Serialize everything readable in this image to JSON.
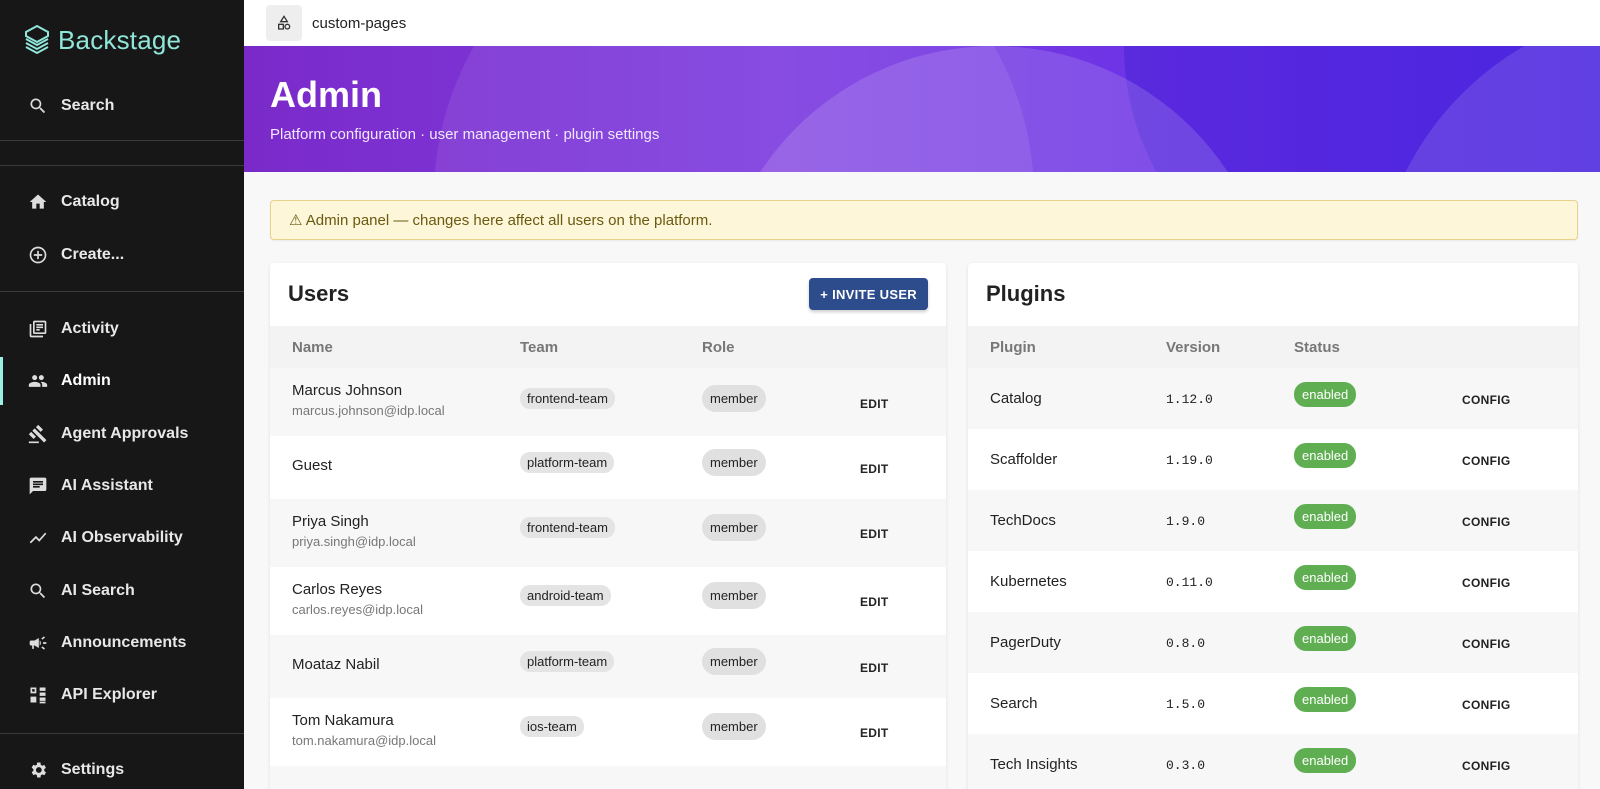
{
  "sidebar": {
    "brand": "Backstage",
    "search_label": "Search",
    "items": [
      {
        "label": "Catalog",
        "icon": "home-icon"
      },
      {
        "label": "Create...",
        "icon": "add-circle-icon"
      },
      {
        "label": "Activity",
        "icon": "activity-icon"
      },
      {
        "label": "Admin",
        "icon": "people-icon",
        "active": true
      },
      {
        "label": "Agent Approvals",
        "icon": "gavel-icon"
      },
      {
        "label": "AI Assistant",
        "icon": "chat-icon"
      },
      {
        "label": "AI Observability",
        "icon": "trending-icon"
      },
      {
        "label": "AI Search",
        "icon": "search-icon"
      },
      {
        "label": "Announcements",
        "icon": "megaphone-icon"
      },
      {
        "label": "API Explorer",
        "icon": "api-icon"
      }
    ],
    "settings_label": "Settings"
  },
  "topbar": {
    "breadcrumb": "custom-pages"
  },
  "header": {
    "title": "Admin",
    "subtitle": "Platform configuration · user management · plugin settings"
  },
  "warning": {
    "text": "⚠ Admin panel — changes here affect all users on the platform."
  },
  "users": {
    "title": "Users",
    "invite_label": "+ INVITE USER",
    "columns": [
      "Name",
      "Team",
      "Role"
    ],
    "edit_label": "EDIT",
    "rows": [
      {
        "name": "Marcus Johnson",
        "email": "marcus.johnson@idp.local",
        "team": "frontend-team",
        "role": "member"
      },
      {
        "name": "Guest",
        "email": "",
        "team": "platform-team",
        "role": "member"
      },
      {
        "name": "Priya Singh",
        "email": "priya.singh@idp.local",
        "team": "frontend-team",
        "role": "member"
      },
      {
        "name": "Carlos Reyes",
        "email": "carlos.reyes@idp.local",
        "team": "android-team",
        "role": "member"
      },
      {
        "name": "Moataz Nabil",
        "email": "",
        "team": "platform-team",
        "role": "member"
      },
      {
        "name": "Tom Nakamura",
        "email": "tom.nakamura@idp.local",
        "team": "ios-team",
        "role": "member"
      }
    ]
  },
  "plugins": {
    "title": "Plugins",
    "columns": [
      "Plugin",
      "Version",
      "Status"
    ],
    "config_label": "CONFIG",
    "rows": [
      {
        "name": "Catalog",
        "version": "1.12.0",
        "status": "enabled"
      },
      {
        "name": "Scaffolder",
        "version": "1.19.0",
        "status": "enabled"
      },
      {
        "name": "TechDocs",
        "version": "1.9.0",
        "status": "enabled"
      },
      {
        "name": "Kubernetes",
        "version": "0.11.0",
        "status": "enabled"
      },
      {
        "name": "PagerDuty",
        "version": "0.8.0",
        "status": "enabled"
      },
      {
        "name": "Search",
        "version": "1.5.0",
        "status": "enabled"
      },
      {
        "name": "Tech Insights",
        "version": "0.3.0",
        "status": "enabled"
      }
    ]
  },
  "colors": {
    "sidebar_bg": "#171717",
    "brand_teal": "#8fe6d9",
    "banner_purple": "#7b2ac9",
    "button_blue": "#2c4c8c",
    "status_green": "#5fae52",
    "warning_bg": "#fdf6d9"
  }
}
